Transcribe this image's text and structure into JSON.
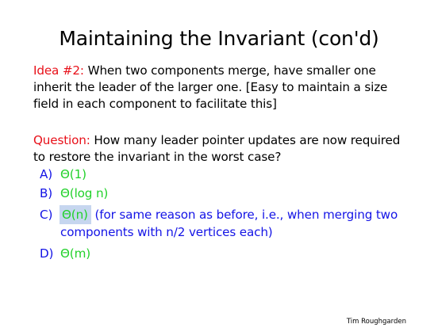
{
  "slide": {
    "title": "Maintaining the Invariant (con'd)",
    "idea": {
      "label": "Idea #2:",
      "text": " When two components merge, have smaller one inherit the leader of the larger one. [Easy to maintain a size field in each component to facilitate this]"
    },
    "question": {
      "label": "Question:",
      "text": " How many leader pointer updates are now required to restore the invariant in the worst case?"
    },
    "options": [
      {
        "letter": "A)",
        "answer": "Θ(1)"
      },
      {
        "letter": "B)",
        "answer": "Θ(log n)"
      },
      {
        "letter": "C)",
        "answer": "Θ(n)",
        "explanation": " (for same reason as before, i.e., when merging two",
        "explanation_cont": "components with n/2 vertices each)"
      },
      {
        "letter": "D)",
        "answer": "Θ(m)"
      }
    ],
    "author": "Tim Roughgarden",
    "colors": {
      "label_red": "#e8111a",
      "answer_green": "#21d12a",
      "text_blue": "#1414e6",
      "highlight": "#c6d6ef"
    }
  }
}
